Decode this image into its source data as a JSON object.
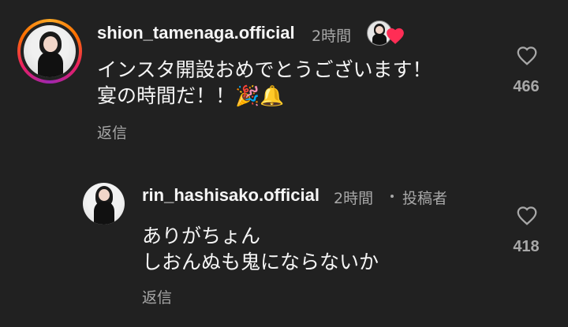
{
  "comments": [
    {
      "username": "shion_tamenaga.official",
      "time": "2時間",
      "text_line1": "インスタ開設おめでとうございます！",
      "text_line2": "宴の時間だ！！🎉🔔",
      "reply_label": "返信",
      "like_count": "466",
      "heart_icon": "heart-outline-icon",
      "creator_liked_icon": "red-heart-icon"
    },
    {
      "username": "rin_hashisako.official",
      "time": "2時間",
      "author_label": "投稿者",
      "text_line1": "ありがちょん",
      "text_line2": "しおんぬも鬼にならないか",
      "reply_label": "返信",
      "like_count": "418",
      "heart_icon": "heart-outline-icon"
    }
  ],
  "colors": {
    "background": "#212121",
    "primary_text": "#f5f5f5",
    "secondary_text": "#a8a8a8",
    "liked_heart": "#ff2d55"
  }
}
